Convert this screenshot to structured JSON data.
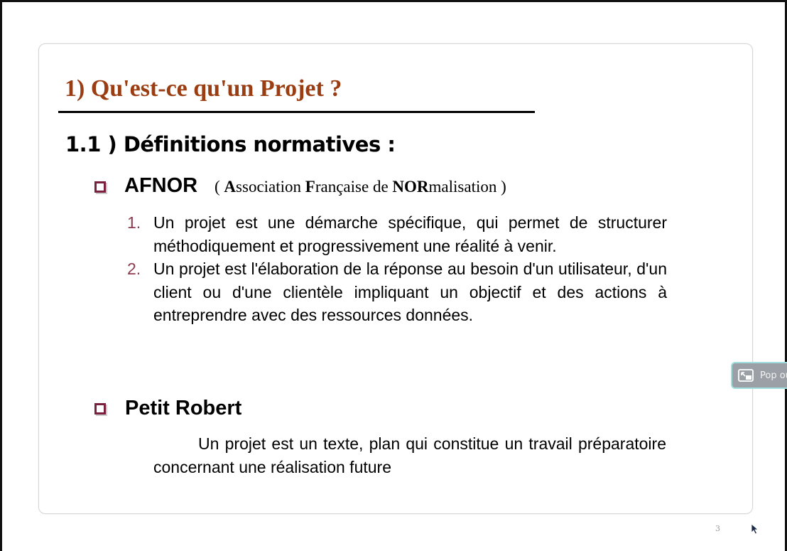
{
  "slide": {
    "title": "1) Qu'est-ce qu'un Projet ?",
    "subtitle": "1.1 ) Définitions normatives :",
    "afnor": {
      "heading": "AFNOR",
      "full_name_parts": [
        "( ",
        "A",
        "ssociation ",
        "F",
        "rançaise de ",
        "NOR",
        "malisation )"
      ],
      "definitions": [
        {
          "number": "1.",
          "text": "Un projet est une démarche spécifique, qui permet de structurer méthodiquement et progressivement une réalité à venir."
        },
        {
          "number": "2.",
          "text": "Un projet est l'élaboration de la réponse au besoin d'un utilisateur, d'un client ou d'une clientèle impliquant un objectif et des actions à entreprendre avec des ressources données."
        }
      ]
    },
    "petit_robert": {
      "heading": "Petit Robert",
      "text": "Un projet est un texte, plan qui constitue un travail préparatoire concernant une réalisation future"
    }
  },
  "viewer": {
    "page_number": "3",
    "popout_label": "Pop out",
    "popout_icon": "popout-icon",
    "cursor_icon": "mouse-pointer-icon"
  },
  "colors": {
    "title": "#9b3d12",
    "bullet": "#7a1f3d",
    "list_number": "#8e3a4f",
    "popout_border": "#9fdede"
  }
}
